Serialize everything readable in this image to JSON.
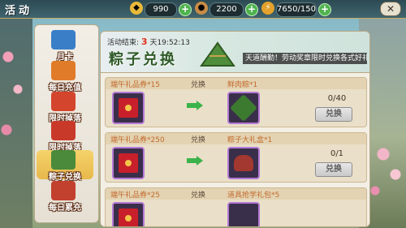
{
  "header": {
    "title": "活动",
    "currencies": [
      {
        "icon": "gold-ingot-icon",
        "value": "990"
      },
      {
        "icon": "copper-coin-icon",
        "value": "2200"
      },
      {
        "icon": "energy-bolt-icon",
        "value": "7650/150"
      }
    ],
    "close_icon": "close-icon"
  },
  "sidebar": {
    "items": [
      {
        "label": "月卡",
        "icon": "monthly-card-icon"
      },
      {
        "label": "每日充值",
        "icon": "daily-recharge-icon"
      },
      {
        "label": "限时掉落",
        "icon": "limited-drop-icon"
      },
      {
        "label": "限时掉落",
        "icon": "limited-drop-icon"
      },
      {
        "label": "粽子兑换",
        "icon": "zongzi-exchange-icon",
        "active": true
      },
      {
        "label": "每日累充",
        "icon": "daily-cumulative-recharge-icon"
      }
    ]
  },
  "banner": {
    "timer_prefix": "活动结束:",
    "timer_days": "3",
    "timer_suffix": "天19:52:13",
    "title": "粽子兑换",
    "description": "天道酬勤！劳动奖章限时兑换各式好礼！"
  },
  "exchange": {
    "exchange_label": "兑换",
    "button_label": "兑换",
    "rows": [
      {
        "need": "端午礼品券*15",
        "reward": "鲜肉粽*1",
        "count": "0/40"
      },
      {
        "need": "端午礼品券*250",
        "reward": "粽子大礼盒*1",
        "count": "0/1"
      },
      {
        "need": "端午礼品券*25",
        "reward": "道具抢学礼包*5",
        "count": ""
      }
    ]
  },
  "colors": {
    "accent_gold": "#e8b84a",
    "count_text": "#3d3328",
    "disabled_button": "#c9c9c9",
    "timer_days": "#e0321e"
  }
}
